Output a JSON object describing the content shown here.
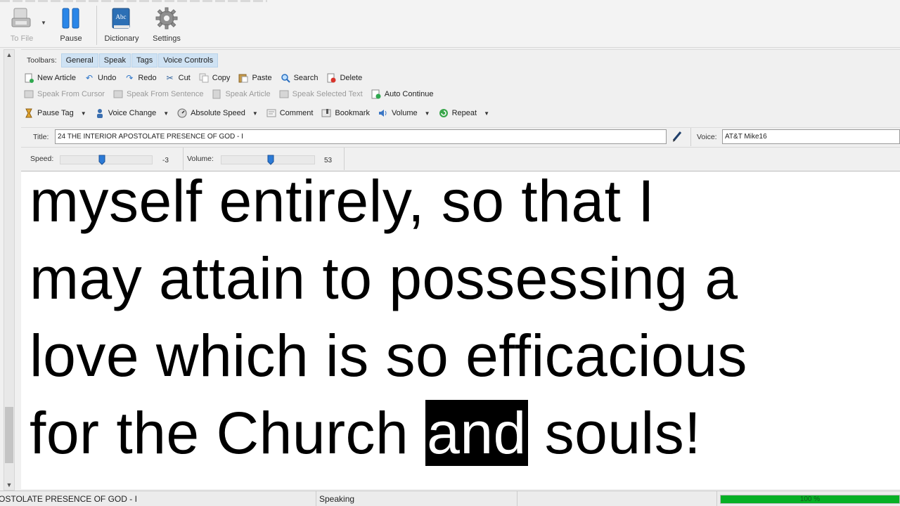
{
  "ribbon": {
    "to_file": "To File",
    "pause": "Pause",
    "dictionary": "Dictionary",
    "dictionary_icon_text": "Abc",
    "settings": "Settings"
  },
  "toolbars": {
    "label": "Toolbars:",
    "tabs": [
      "General",
      "Speak",
      "Tags",
      "Voice Controls"
    ]
  },
  "general_row": {
    "new_article": "New Article",
    "undo": "Undo",
    "redo": "Redo",
    "cut": "Cut",
    "copy": "Copy",
    "paste": "Paste",
    "search": "Search",
    "delete": "Delete"
  },
  "speak_row": {
    "speak_from_cursor": "Speak From Cursor",
    "speak_from_sentence": "Speak From Sentence",
    "speak_article": "Speak Article",
    "speak_selected_text": "Speak Selected Text",
    "auto_continue": "Auto Continue"
  },
  "tags_row": {
    "pause_tag": "Pause Tag",
    "voice_change": "Voice Change",
    "absolute_speed": "Absolute Speed",
    "comment": "Comment",
    "bookmark": "Bookmark",
    "volume": "Volume",
    "repeat": "Repeat"
  },
  "title_field": {
    "label": "Title:",
    "value": "24 THE INTERIOR APOSTOLATE PRESENCE OF GOD - I"
  },
  "voice_field": {
    "label": "Voice:",
    "value": "AT&T Mike16"
  },
  "speed": {
    "label": "Speed:",
    "value": "-3",
    "level": 0.45
  },
  "volume": {
    "label": "Volume:",
    "value": "53",
    "level": 0.53
  },
  "content": {
    "lines": [
      "myself entirely, so that I",
      "may attain to possessing a",
      "love which is so efficacious"
    ],
    "line4_before": "for the Church ",
    "highlighted_word": "and",
    "line4_after": " souls!"
  },
  "status": {
    "title": "OSTOLATE PRESENCE OF GOD - I",
    "state": "Speaking",
    "progress_text": "100 %"
  },
  "colors": {
    "tab_bg": "#cfe2f3",
    "progress": "#06b025",
    "highlight_bg": "#000000",
    "highlight_fg": "#ffffff"
  }
}
